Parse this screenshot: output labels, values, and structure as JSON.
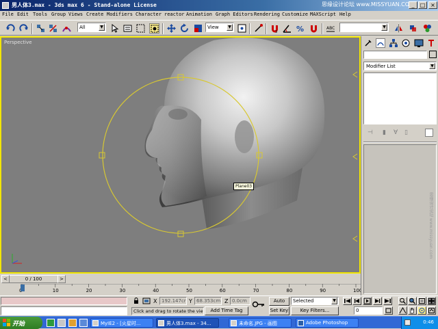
{
  "window": {
    "title": "男人体3.max - 3ds max 6 - Stand-alone License",
    "watermark": "思缘设计论坛 www.MISSYUAN.COM"
  },
  "menu": {
    "items": [
      "File",
      "Edit",
      "Tools",
      "Group",
      "Views",
      "Create",
      "Modifiers",
      "Character",
      "reactor",
      "Animation",
      "Graph Editors",
      "Rendering",
      "Customize",
      "MAXScript",
      "Help"
    ]
  },
  "toolbar": {
    "selection_filter": "All",
    "reference_coord": "View",
    "active_tool": "select-and-rotate"
  },
  "viewport": {
    "label": "Perspective",
    "object_label": "Plane03",
    "side_watermark": "思缘设计论坛 www.missyuan.com"
  },
  "trackbar": {
    "frame_slider": "0 / 100",
    "ruler_ticks": [
      "0",
      "10",
      "20",
      "30",
      "40",
      "50",
      "60",
      "70",
      "80",
      "90",
      "100"
    ]
  },
  "command_panel": {
    "modifier_list": "Modifier List"
  },
  "status": {
    "x_label": "X",
    "x_value": "192.147cr",
    "y_label": "Y",
    "y_value": "68.353cm",
    "z_label": "Z",
    "z_value": "0.0cm",
    "message": "Click and drag to rotate the view.",
    "add_time_tag": "Add Time Tag",
    "auto_key": "Auto Key",
    "set_key": "Set Key",
    "key_mode": "Selected",
    "key_filters": "Key Filters...",
    "current_frame": "0"
  },
  "taskbar": {
    "start": "开始",
    "tasks": [
      {
        "label": "MyIE2 - [火星时..."
      },
      {
        "label": "男人体3.max - 34..."
      },
      {
        "label": "未命名.JPG - 画图"
      },
      {
        "label": "Adobe Photoshop"
      }
    ],
    "clock": "0:46"
  },
  "colors": {
    "viewport_bg": "#7e7e7e",
    "active_border": "#f2e600",
    "gizmo": "#d8c832",
    "titlebar": "#0a246a"
  }
}
